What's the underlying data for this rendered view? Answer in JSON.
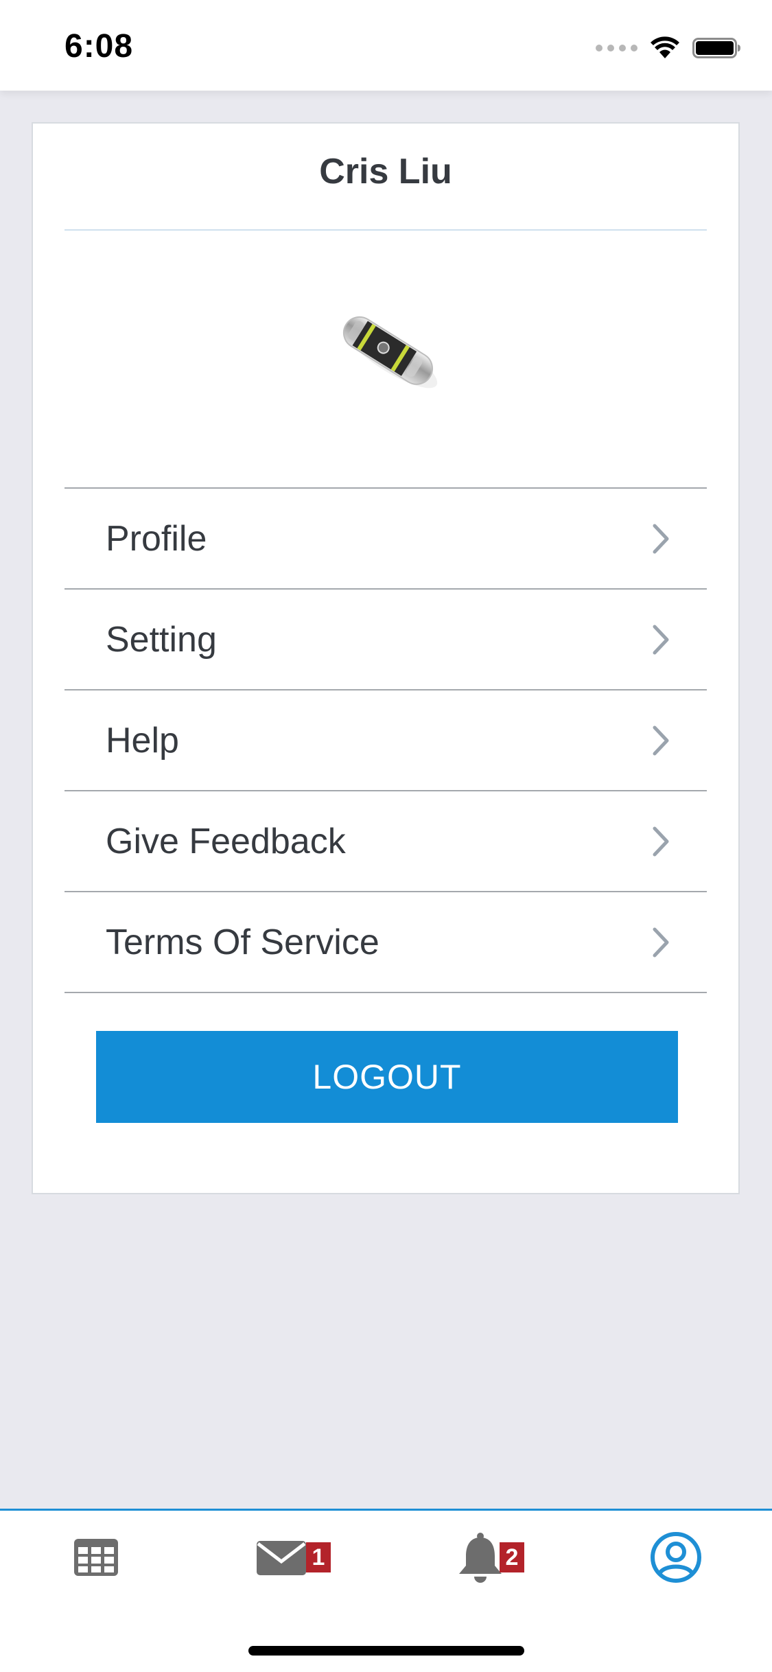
{
  "status_bar": {
    "time": "6:08"
  },
  "user": {
    "name": "Cris Liu"
  },
  "menu": {
    "items": [
      {
        "label": "Profile"
      },
      {
        "label": "Setting"
      },
      {
        "label": "Help"
      },
      {
        "label": "Give Feedback"
      },
      {
        "label": "Terms Of Service"
      }
    ]
  },
  "logout": {
    "label": "LOGOUT"
  },
  "tab_bar": {
    "tabs": [
      {
        "icon": "grid-icon",
        "badge": ""
      },
      {
        "icon": "mail-icon",
        "badge": "1"
      },
      {
        "icon": "bell-icon",
        "badge": "2"
      },
      {
        "icon": "user-circle-icon",
        "badge": "",
        "active": true
      }
    ]
  },
  "colors": {
    "accent": "#138dd6",
    "badge": "#b3232a",
    "background": "#e9e9ef",
    "icon_gray": "#6d6d6d"
  }
}
